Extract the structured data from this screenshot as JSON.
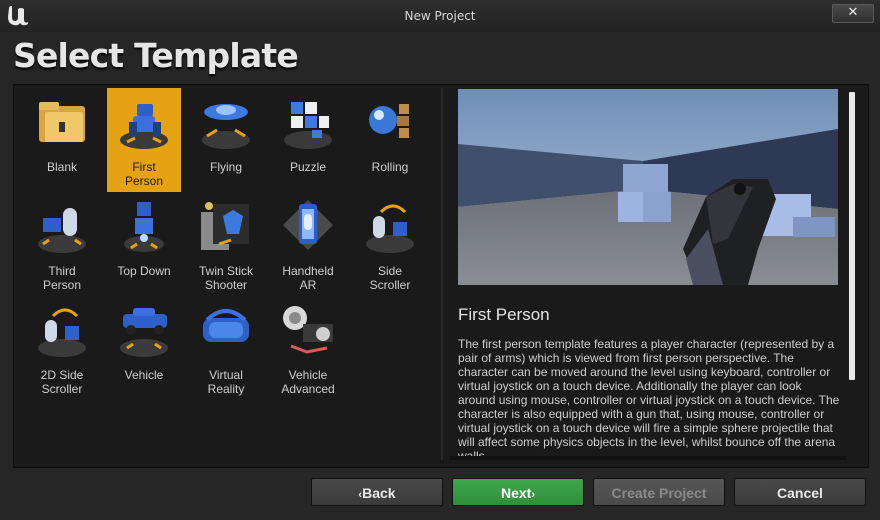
{
  "window": {
    "title": "New Project",
    "close_glyph": "✕"
  },
  "page": {
    "heading": "Select Template"
  },
  "templates": [
    {
      "label": "Blank",
      "icon": "folder-icon"
    },
    {
      "label": "First\nPerson",
      "icon": "first-person-robot-icon",
      "selected": true
    },
    {
      "label": "Flying",
      "icon": "flying-ship-icon"
    },
    {
      "label": "Puzzle",
      "icon": "puzzle-blocks-icon"
    },
    {
      "label": "Rolling",
      "icon": "rolling-ball-icon"
    },
    {
      "label": "Third\nPerson",
      "icon": "third-person-robot-icon"
    },
    {
      "label": "Top Down",
      "icon": "top-down-robot-icon"
    },
    {
      "label": "Twin Stick\nShooter",
      "icon": "twin-stick-ship-icon"
    },
    {
      "label": "Handheld\nAR",
      "icon": "handheld-ar-phone-icon"
    },
    {
      "label": "Side\nScroller",
      "icon": "side-scroller-icon"
    },
    {
      "label": "2D Side\nScroller",
      "icon": "2d-side-scroller-icon"
    },
    {
      "label": "Vehicle",
      "icon": "vehicle-car-icon"
    },
    {
      "label": "Virtual\nReality",
      "icon": "vr-headset-icon"
    },
    {
      "label": "Vehicle\nAdvanced",
      "icon": "vehicle-advanced-icon"
    }
  ],
  "details": {
    "title": "First Person",
    "description": "The first person template features a player character (represented by a pair of arms) which is viewed from first person perspective. The character can be moved around the level using keyboard, controller or virtual joystick on a touch device. Additionally the player can look around using mouse, controller or virtual joystick on a touch device. The character is also equipped with a gun that, using mouse, controller or virtual joystick on a touch device will fire a simple sphere projectile that will affect some physics objects in the level, whilst bounce off the arena walls."
  },
  "buttons": {
    "back": {
      "label": "Back",
      "chevron": "‹"
    },
    "next": {
      "label": "Next",
      "chevron": "›"
    },
    "create": {
      "label": "Create Project"
    },
    "cancel": {
      "label": "Cancel"
    }
  },
  "colors": {
    "selected": "#e5a313",
    "next": "#3fa64a",
    "panel": "#1a1a1a"
  }
}
